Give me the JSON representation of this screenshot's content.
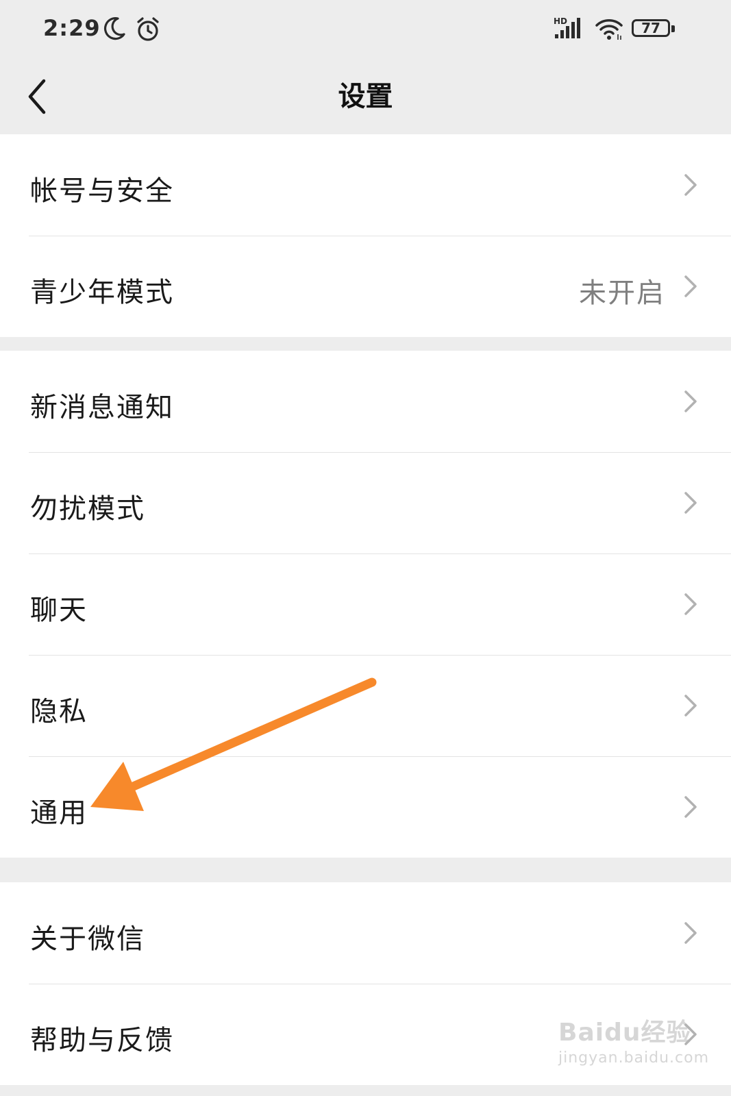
{
  "status_bar": {
    "time": "2:29",
    "network_label": "HD",
    "battery": "77",
    "icons": [
      "moon-icon",
      "alarm-icon",
      "signal-icon",
      "wifi-icon",
      "battery-icon"
    ]
  },
  "header": {
    "title": "设置",
    "back_icon": "chevron-left-icon"
  },
  "groups": [
    {
      "items": [
        {
          "label": "帐号与安全",
          "value": ""
        },
        {
          "label": "青少年模式",
          "value": "未开启"
        }
      ]
    },
    {
      "items": [
        {
          "label": "新消息通知",
          "value": ""
        },
        {
          "label": "勿扰模式",
          "value": ""
        },
        {
          "label": "聊天",
          "value": ""
        },
        {
          "label": "隐私",
          "value": ""
        },
        {
          "label": "通用",
          "value": ""
        }
      ]
    },
    {
      "items": [
        {
          "label": "关于微信",
          "value": ""
        },
        {
          "label": "帮助与反馈",
          "value": ""
        }
      ]
    }
  ],
  "annotation": {
    "color": "#f7892b",
    "points_to": "通用"
  },
  "watermark": {
    "main": "Baidu经验",
    "sub": "jingyan.baidu.com"
  },
  "colors": {
    "background": "#ededed",
    "card": "#ffffff",
    "divider": "#e3e3e3",
    "secondary_text": "#7f7f7f",
    "chevron": "#b2b2b2"
  }
}
